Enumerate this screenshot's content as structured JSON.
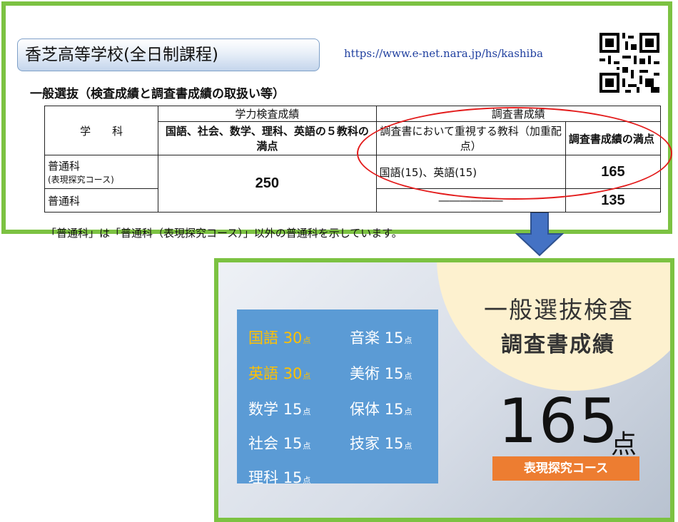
{
  "header": {
    "school_title": "香芝高等学校(全日制課程)",
    "url": "https://www.e-net.nara.jp/hs/kashiba",
    "subheading": "一般選抜（検査成績と調査書成績の取扱い等）"
  },
  "table": {
    "col_department": "学　　科",
    "col_exam": "学力検査成績",
    "col_exam_sub": "国語、社会、数学、理科、英語の５教科の満点",
    "col_report": "調査書成績",
    "col_report_weighted": "調査書において重視する教科（加重配点）",
    "col_report_full": "調査書成績の満点",
    "rows": [
      {
        "department": "普通科",
        "department_note": "(表現探究コース)",
        "weighted_subjects": "国語(15)、英語(15)",
        "report_full": "165"
      },
      {
        "department": "普通科",
        "weighted_subjects": "――――――",
        "report_full": "135"
      }
    ],
    "exam_full": "250"
  },
  "footnote": "「普通科」は「普通科（表現探究コース）」以外の普通科を示しています。",
  "summary": {
    "heading_line1": "一般選抜検査",
    "heading_line2": "調査書成績",
    "point_unit": "点",
    "subjects": [
      {
        "name": "国語",
        "score": "30",
        "highlight": true
      },
      {
        "name": "英語",
        "score": "30",
        "highlight": true
      },
      {
        "name": "数学",
        "score": "15",
        "highlight": false
      },
      {
        "name": "社会",
        "score": "15",
        "highlight": false
      },
      {
        "name": "理科",
        "score": "15",
        "highlight": false
      },
      {
        "name": "音楽",
        "score": "15",
        "highlight": false
      },
      {
        "name": "美術",
        "score": "15",
        "highlight": false
      },
      {
        "name": "保体",
        "score": "15",
        "highlight": false
      },
      {
        "name": "技家",
        "score": "15",
        "highlight": false
      }
    ],
    "total": "165",
    "course_badge": "表現探究コース"
  },
  "colors": {
    "frame_green": "#7cc242",
    "ellipse_red": "#e31b1b",
    "arrow_blue": "#4472c4",
    "subject_box_blue": "#5b9bd5",
    "highlight_yellow": "#ffc000",
    "badge_orange": "#ed7d31",
    "circle_cream": "#fdf1cf"
  },
  "icons": [
    "qr-code-icon",
    "down-arrow-icon"
  ]
}
